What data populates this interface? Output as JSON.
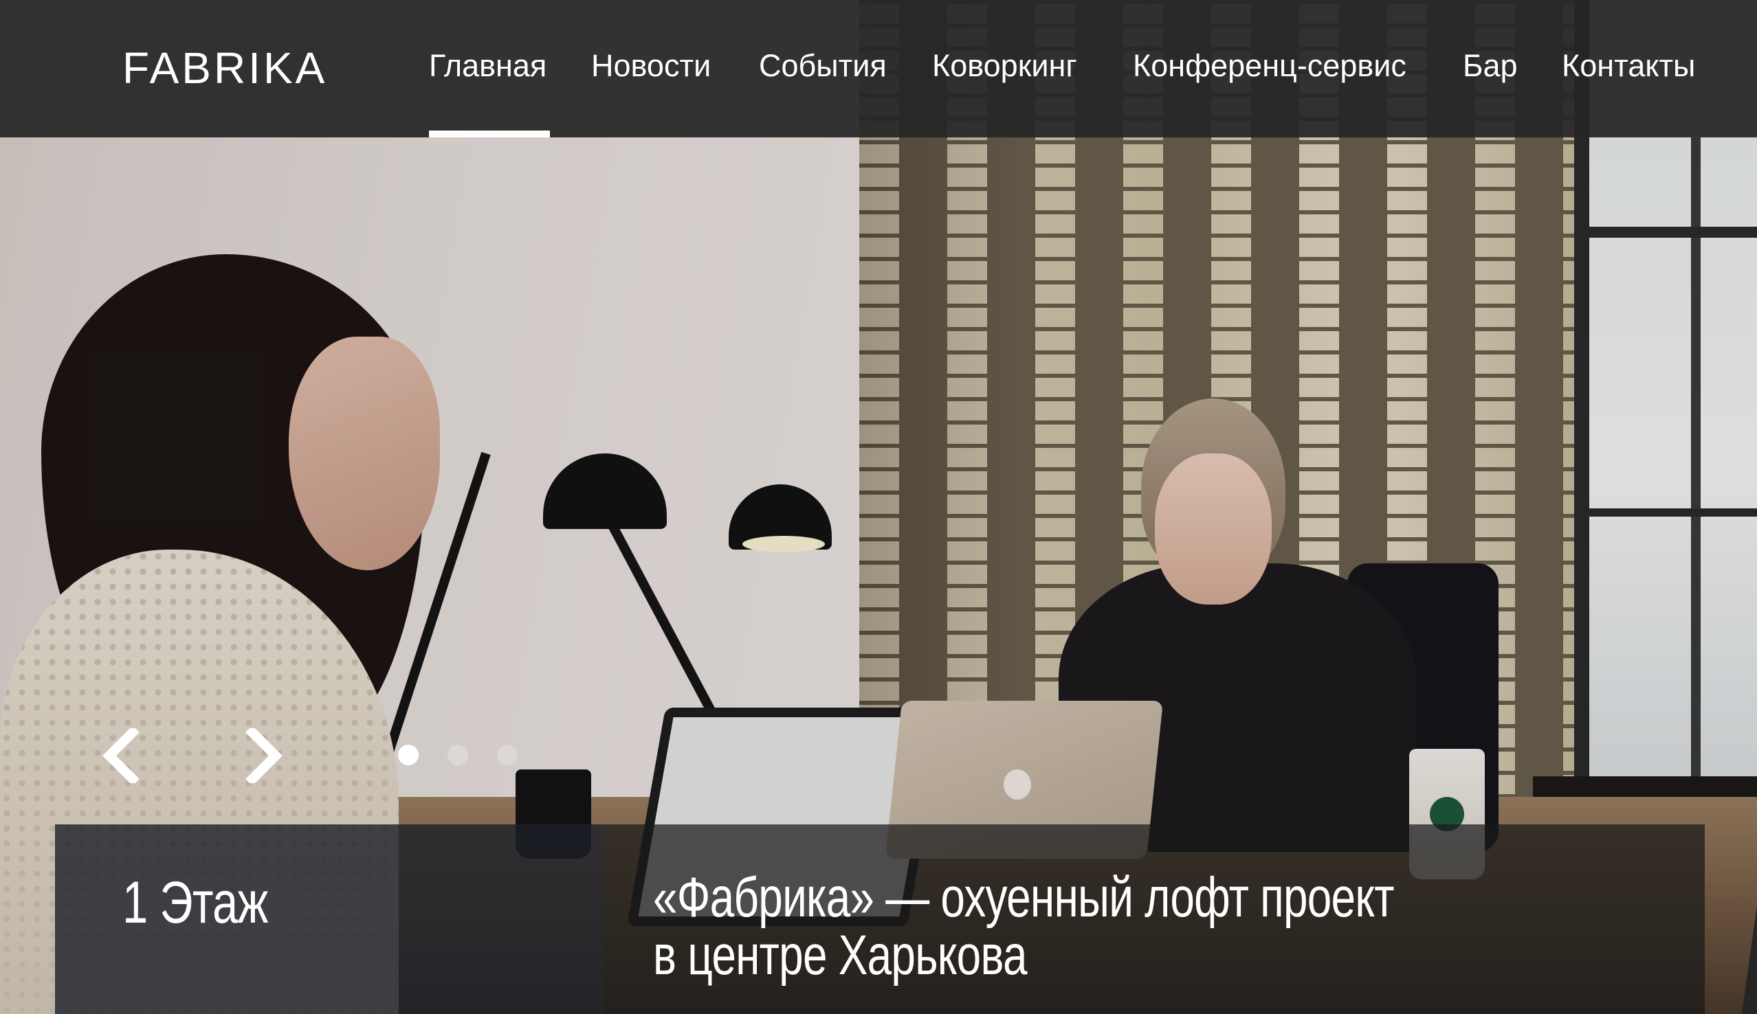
{
  "site": {
    "logo": "FABRIKA"
  },
  "nav": {
    "items": [
      {
        "label": "Главная",
        "active": true
      },
      {
        "label": "Новости",
        "active": false
      },
      {
        "label": "События",
        "active": false
      },
      {
        "label": "Коворкинг",
        "active": false
      },
      {
        "label": "Конференц-сервис",
        "active": false
      },
      {
        "label": "Бар",
        "active": false
      },
      {
        "label": "Контакты",
        "active": false
      }
    ]
  },
  "slider": {
    "prev_icon": "chevron-left-icon",
    "next_icon": "chevron-right-icon",
    "dots_total": 3,
    "active_dot": 1,
    "floor_label": "1 Этаж",
    "headline_line1": "«Фабрика» — охуенный лофт проект",
    "headline_line2": "в центре Харькова"
  },
  "colors": {
    "header_bg": "#262626",
    "text": "#ffffff",
    "caption_left_bg": "#1c1f28",
    "caption_right_bg": "#191919"
  }
}
